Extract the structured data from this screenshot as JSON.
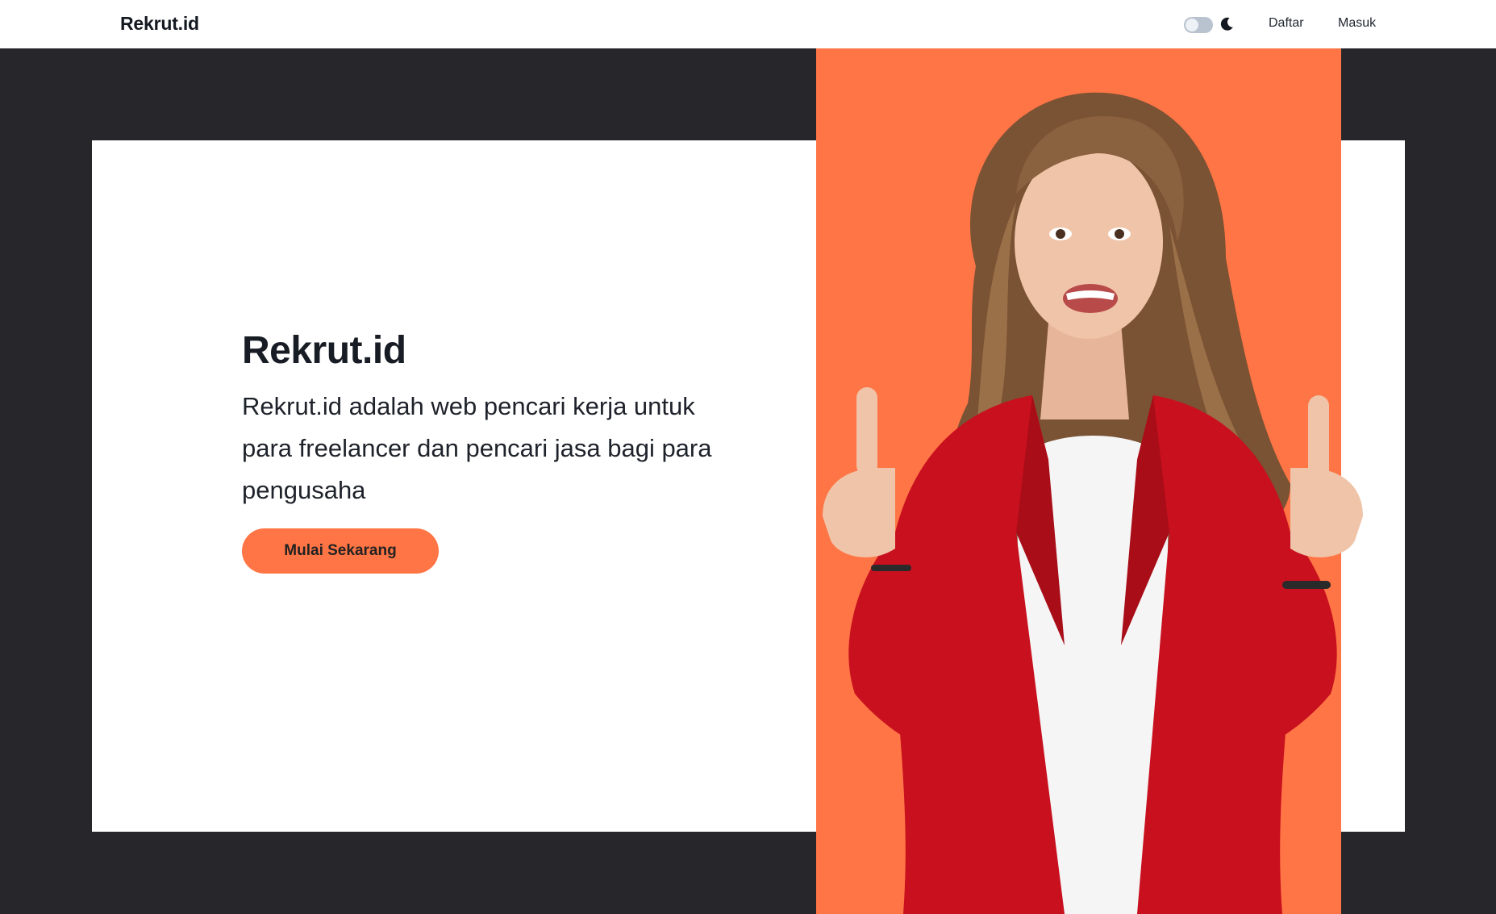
{
  "navbar": {
    "brand": "Rekrut.id",
    "theme_toggle": {
      "state": "off",
      "icon": "moon-icon"
    },
    "links": {
      "daftar": "Daftar",
      "masuk": "Masuk"
    }
  },
  "hero": {
    "title": "Rekrut.id",
    "description": "Rekrut.id adalah web pencari kerja untuk para freelancer dan pencari jasa bagi para pengusaha",
    "cta_label": "Mulai Sekarang"
  },
  "colors": {
    "accent": "#ff7545",
    "dark_background": "#26262b",
    "card_background": "#ffffff",
    "blazer": "#c8101e"
  }
}
